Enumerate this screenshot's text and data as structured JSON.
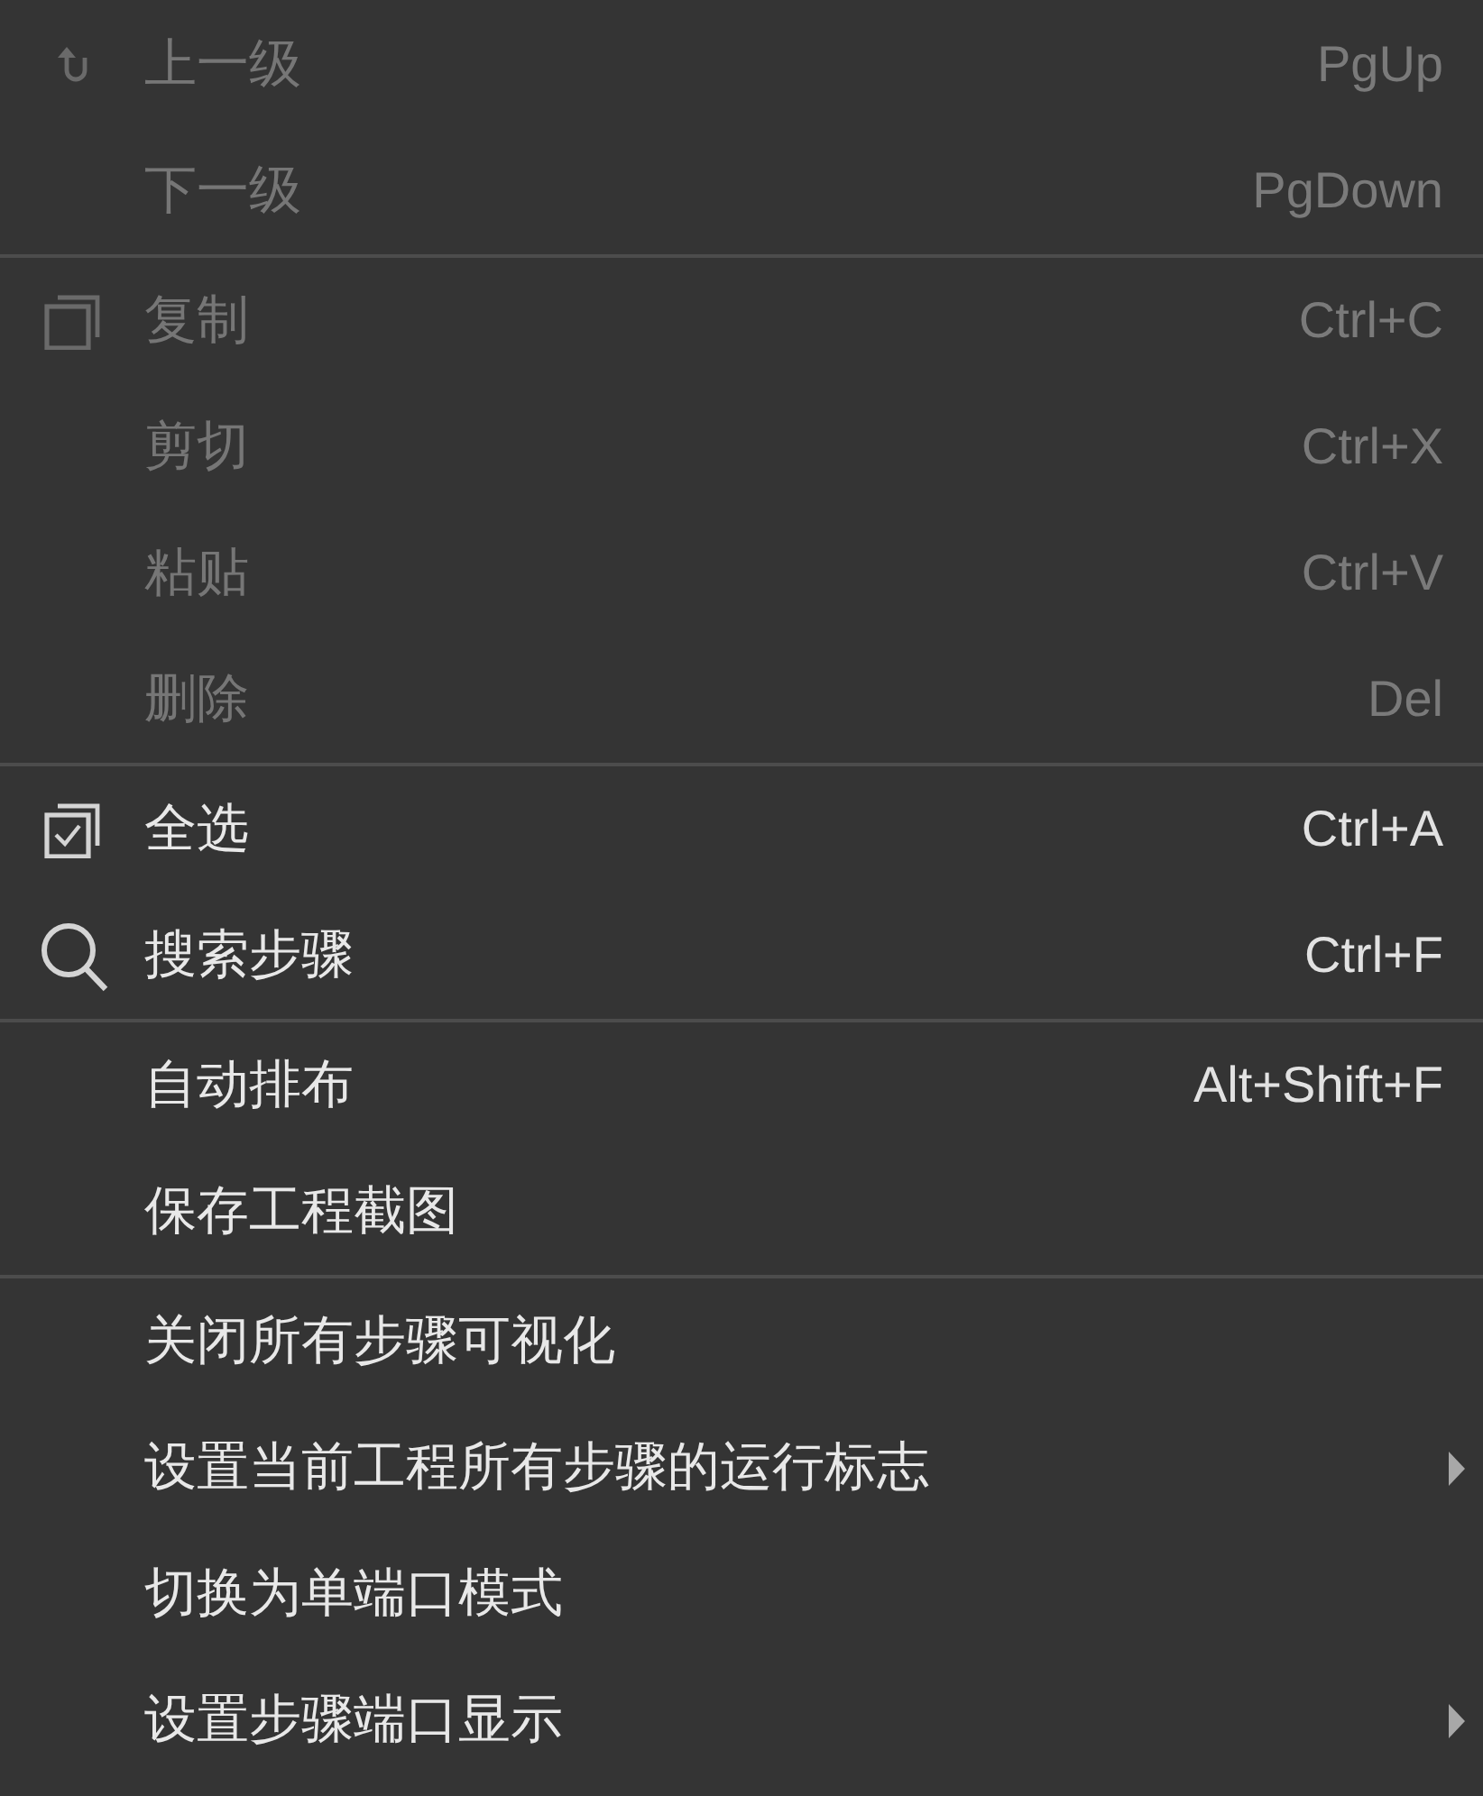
{
  "menu": {
    "groups": [
      {
        "items": [
          {
            "kind": "undo",
            "label": "上一级",
            "shortcut": "PgUp",
            "disabled": true,
            "submenu": false
          },
          {
            "kind": "plain",
            "label": "下一级",
            "shortcut": "PgDown",
            "disabled": true,
            "submenu": false
          }
        ]
      },
      {
        "items": [
          {
            "kind": "copy",
            "label": "复制",
            "shortcut": "Ctrl+C",
            "disabled": true,
            "submenu": false
          },
          {
            "kind": "plain",
            "label": "剪切",
            "shortcut": "Ctrl+X",
            "disabled": true,
            "submenu": false
          },
          {
            "kind": "plain",
            "label": "粘贴",
            "shortcut": "Ctrl+V",
            "disabled": true,
            "submenu": false
          },
          {
            "kind": "plain",
            "label": "删除",
            "shortcut": "Del",
            "disabled": true,
            "submenu": false
          }
        ]
      },
      {
        "items": [
          {
            "kind": "select",
            "label": "全选",
            "shortcut": "Ctrl+A",
            "disabled": false,
            "submenu": false
          },
          {
            "kind": "search",
            "label": "搜索步骤",
            "shortcut": "Ctrl+F",
            "disabled": false,
            "submenu": false
          }
        ]
      },
      {
        "items": [
          {
            "kind": "plain",
            "label": "自动排布",
            "shortcut": "Alt+Shift+F",
            "disabled": false,
            "submenu": false
          },
          {
            "kind": "plain",
            "label": "保存工程截图",
            "disabled": false,
            "submenu": false
          }
        ]
      },
      {
        "items": [
          {
            "kind": "plain",
            "label": "关闭所有步骤可视化",
            "disabled": false,
            "submenu": false
          },
          {
            "kind": "plain",
            "label": "设置当前工程所有步骤的运行标志",
            "disabled": false,
            "submenu": true
          },
          {
            "kind": "plain",
            "label": "切换为单端口模式",
            "disabled": false,
            "submenu": false
          },
          {
            "kind": "plain",
            "label": "设置步骤端口显示",
            "disabled": false,
            "submenu": true
          }
        ]
      }
    ]
  }
}
